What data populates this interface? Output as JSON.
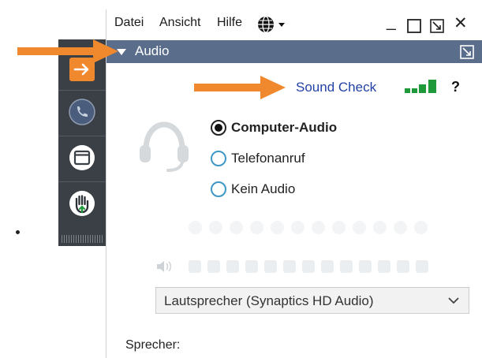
{
  "menu": {
    "file": "Datei",
    "view": "Ansicht",
    "help": "Hilfe"
  },
  "window_controls": {
    "minimize": "_",
    "close": "✕"
  },
  "panel": {
    "title": "Audio"
  },
  "sound_check": {
    "label": "Sound Check",
    "help_label": "?"
  },
  "audio_options": [
    {
      "label": "Computer-Audio",
      "selected": true
    },
    {
      "label": "Telefonanruf",
      "selected": false
    },
    {
      "label": "Kein Audio",
      "selected": false
    }
  ],
  "speaker_select": {
    "value": "Lautsprecher (Synaptics HD Audio)"
  },
  "speaker_label": "Sprecher:",
  "colors": {
    "accent_orange": "#f0892e",
    "header_blue": "#5a6e8c",
    "link_blue": "#2342a5",
    "signal_green": "#1f9a3a",
    "sidebar_dark": "#3b4047"
  }
}
